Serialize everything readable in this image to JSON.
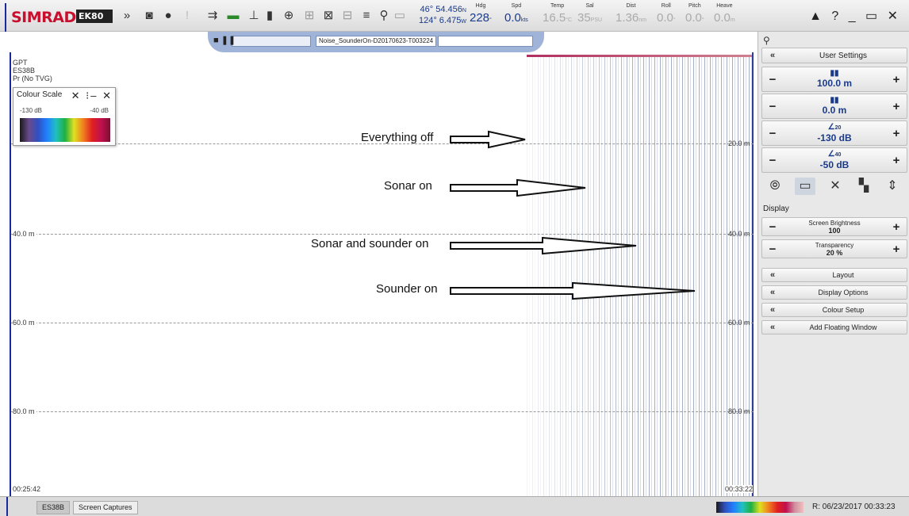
{
  "topbar": {
    "logo": "SIMRAD",
    "product": "EK80",
    "position": {
      "lat": "46° 54.456",
      "lat_hemi": "N",
      "lon": "124° 6.475",
      "lon_hemi": "W"
    },
    "readouts": [
      {
        "label": "Hdg",
        "value": "228",
        "unit": "°",
        "dim": false
      },
      {
        "label": "Spd",
        "value": "0.0",
        "unit": "kts",
        "dim": false
      },
      {
        "label": "Temp",
        "value": "16.5",
        "unit": "°C",
        "dim": true
      },
      {
        "label": "Sal",
        "value": "35",
        "unit": "PSU",
        "dim": true
      },
      {
        "label": "Dist",
        "value": "1.36",
        "unit": "nm",
        "dim": true
      },
      {
        "label": "Roll",
        "value": "0.0",
        "unit": "°",
        "dim": true
      },
      {
        "label": "Pitch",
        "value": "0.0",
        "unit": "°",
        "dim": true
      },
      {
        "label": "Heave",
        "value": "0.0",
        "unit": "m",
        "dim": true
      }
    ],
    "window_controls": "▲ ? _ ▭ ✕"
  },
  "replay": {
    "filename": "Noise_SounderOn-D20170623-T003224"
  },
  "echogram": {
    "info_lines": [
      "GPT",
      "ES38B",
      "Pr (No TVG)"
    ],
    "depth_labels": [
      "20.0 m",
      "40.0 m",
      "60.0 m",
      "80.0 m"
    ],
    "time_start": "00:25:42",
    "time_end": "00:33:22"
  },
  "colour_scale": {
    "title": "Colour Scale",
    "min": "-130 dB",
    "max": "-40 dB",
    "buttons": "✕ ⁝– ✕"
  },
  "annotations": [
    {
      "text": "Everything off"
    },
    {
      "text": "Sonar on"
    },
    {
      "text": "Sonar and sounder on"
    },
    {
      "text": "Sounder on"
    }
  ],
  "panel": {
    "user_settings": "User Settings",
    "range": {
      "value": "100.0 m"
    },
    "start": {
      "value": "0.0 m"
    },
    "gain1": {
      "sup": "20",
      "value": "-130 dB"
    },
    "gain2": {
      "sup": "40",
      "value": "-50 dB"
    },
    "section": "Display",
    "brightness": {
      "label": "Screen Brightness",
      "value": "100"
    },
    "transparency": {
      "label": "Transparency",
      "value": "20 %"
    },
    "menu": [
      "Layout",
      "Display Options",
      "Colour Setup",
      "Add Floating Window"
    ]
  },
  "bottombar": {
    "tabs": [
      "ES38B",
      "Screen Captures"
    ],
    "date": "R: 06/23/2017  00:33:23"
  }
}
